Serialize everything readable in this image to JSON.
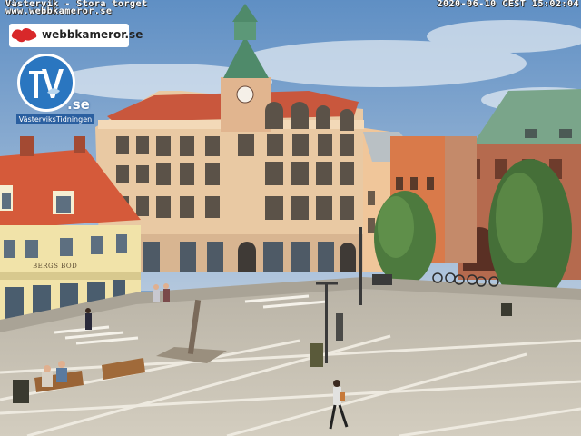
{
  "overlay": {
    "camera_title": "Västervik - Stora torget",
    "camera_url": "www.webbkameror.se",
    "timestamp": "2020-06-10 CEST 15:02:04"
  },
  "logos": {
    "webbkameror": "webbkameror.se",
    "vt_suffix": ".se",
    "vt_name": "VästerviksTidningen"
  },
  "scene": {
    "shop_sign": "BERGS BOD",
    "colors": {
      "sky": "#7fa3c9",
      "cloud": "#e6edf4",
      "main_building": "#e9c9a3",
      "tower_roof": "#4f8a6a",
      "red_roof": "#d55a3a",
      "yellow_building": "#f1e3a9",
      "brick_building": "#b56a4e",
      "green_roof": "#7aa58a",
      "pavement": "#c9c2b4",
      "tree": "#4d7a3e"
    }
  }
}
